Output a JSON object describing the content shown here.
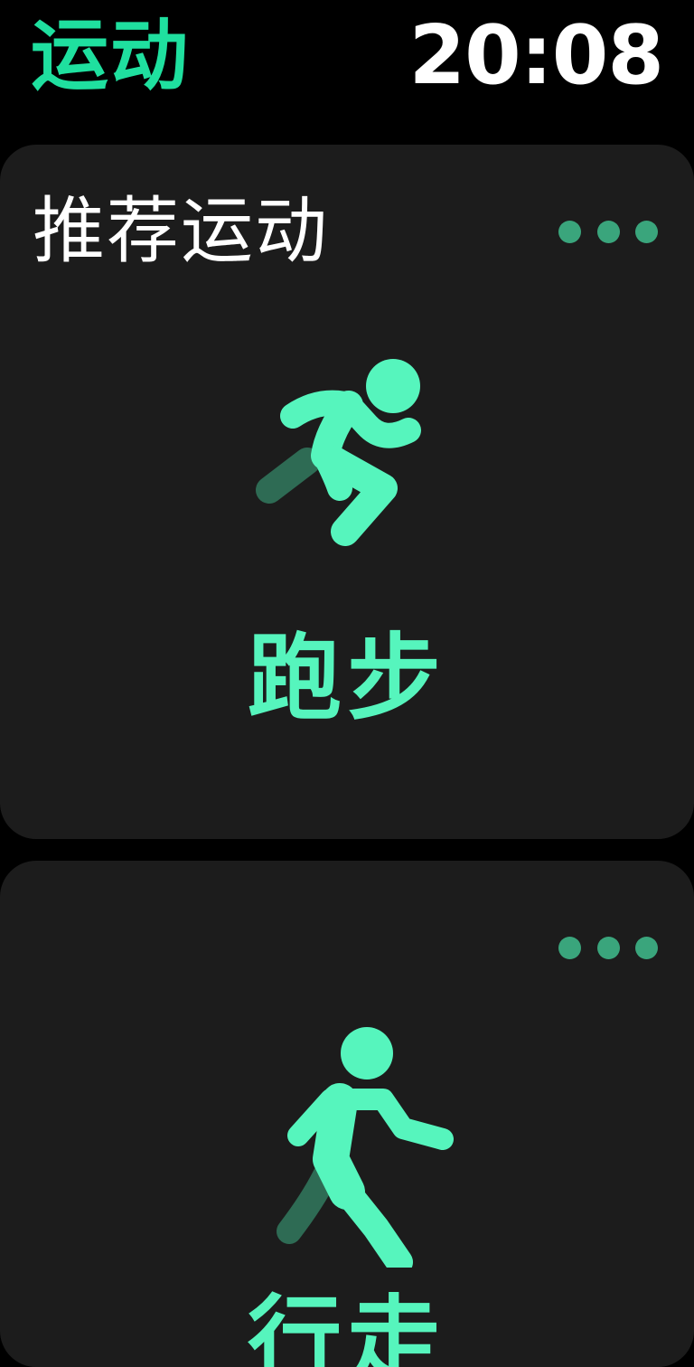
{
  "header": {
    "app_title": "运动",
    "time": "20:08"
  },
  "cards": [
    {
      "title": "推荐运动",
      "activity": "跑步",
      "icon": "running-person-icon"
    },
    {
      "title": "",
      "activity": "行走",
      "icon": "walking-person-icon"
    }
  ],
  "colors": {
    "accent": "#1fe09f",
    "activity_green": "#56f5bd",
    "trail_green": "#2e6b54",
    "card_bg": "#1c1c1c",
    "dots": "#3aa57c",
    "background": "#000000"
  }
}
